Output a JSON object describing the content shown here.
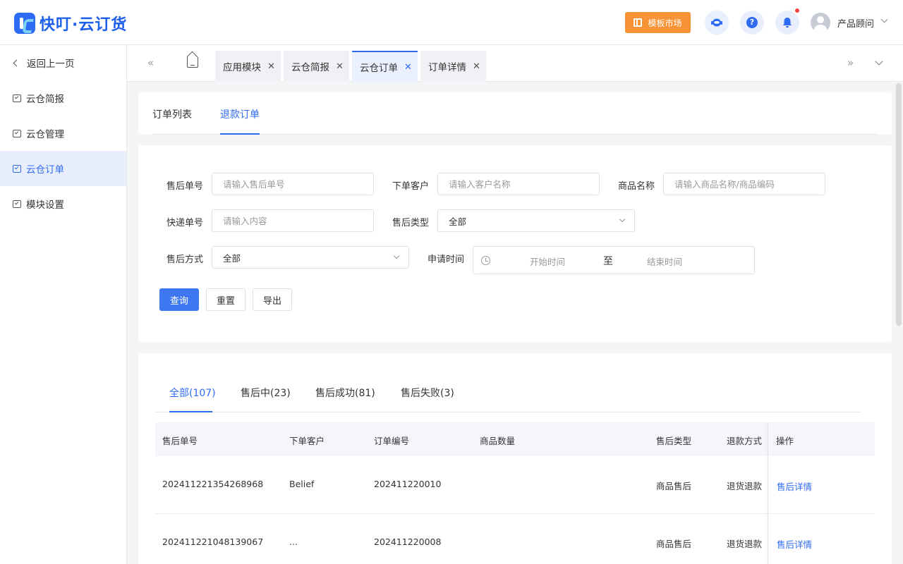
{
  "header": {
    "logo_text": "快叮·云订货",
    "market_button": "模板市场",
    "user_name": "产品顾问",
    "icons": [
      "service-icon",
      "help-icon",
      "bell-icon",
      "avatar"
    ]
  },
  "sidebar": {
    "back_label": "返回上一页",
    "items": [
      {
        "label": "云仓简报",
        "active": false
      },
      {
        "label": "云仓管理",
        "active": false
      },
      {
        "label": "云仓订单",
        "active": true
      },
      {
        "label": "模块设置",
        "active": false
      }
    ]
  },
  "tabbar": {
    "prev_glyph": "«",
    "next_glyph": "»",
    "tabs": [
      {
        "label": "应用模块",
        "active": false
      },
      {
        "label": "云仓简报",
        "active": false
      },
      {
        "label": "云仓订单",
        "active": true
      },
      {
        "label": "订单详情",
        "active": false
      }
    ],
    "close_glyph": "✕"
  },
  "order_tabs": {
    "items": [
      {
        "label": "订单列表",
        "active": false
      },
      {
        "label": "退款订单",
        "active": true
      }
    ]
  },
  "filters": {
    "after_sale_no": {
      "label": "售后单号",
      "placeholder": "请输入售后单号",
      "value": ""
    },
    "customer": {
      "label": "下单客户",
      "placeholder": "请输入客户名称",
      "value": ""
    },
    "product": {
      "label": "商品名称",
      "placeholder": "请输入商品名称/商品编码",
      "value": ""
    },
    "express_no": {
      "label": "快递单号",
      "placeholder": "请输入内容",
      "value": ""
    },
    "after_sale_type": {
      "label": "售后类型",
      "value": "全部"
    },
    "after_sale_method": {
      "label": "售后方式",
      "value": "全部"
    },
    "apply_time": {
      "label": "申请时间",
      "start_placeholder": "开始时间",
      "separator": "至",
      "end_placeholder": "结束时间"
    },
    "buttons": {
      "query": "查询",
      "reset": "重置",
      "export": "导出"
    }
  },
  "status_tabs": [
    {
      "label": "全部(107)",
      "active": true
    },
    {
      "label": "售后中(23)",
      "active": false
    },
    {
      "label": "售后成功(81)",
      "active": false
    },
    {
      "label": "售后失败(3)",
      "active": false
    }
  ],
  "table": {
    "columns": [
      "售后单号",
      "下单客户",
      "订单编号",
      "商品数量",
      "售后类型",
      "退款方式",
      "操作"
    ],
    "rows": [
      {
        "after_sale_no": "202411221354268968",
        "customer": "Belief",
        "order_no": "202411220010",
        "quantity": "",
        "type": "商品售后",
        "refund_method": "退货退款",
        "action": "售后详情"
      },
      {
        "after_sale_no": "202411221048139067",
        "customer": "...",
        "order_no": "202411220008",
        "quantity": "",
        "type": "商品售后",
        "refund_method": "退货退款",
        "action": "售后详情"
      }
    ]
  },
  "colors": {
    "primary": "#2f6bf2",
    "market": "#f79235",
    "active_bg": "#e8eefc",
    "page_bg": "#f4f5f7"
  }
}
